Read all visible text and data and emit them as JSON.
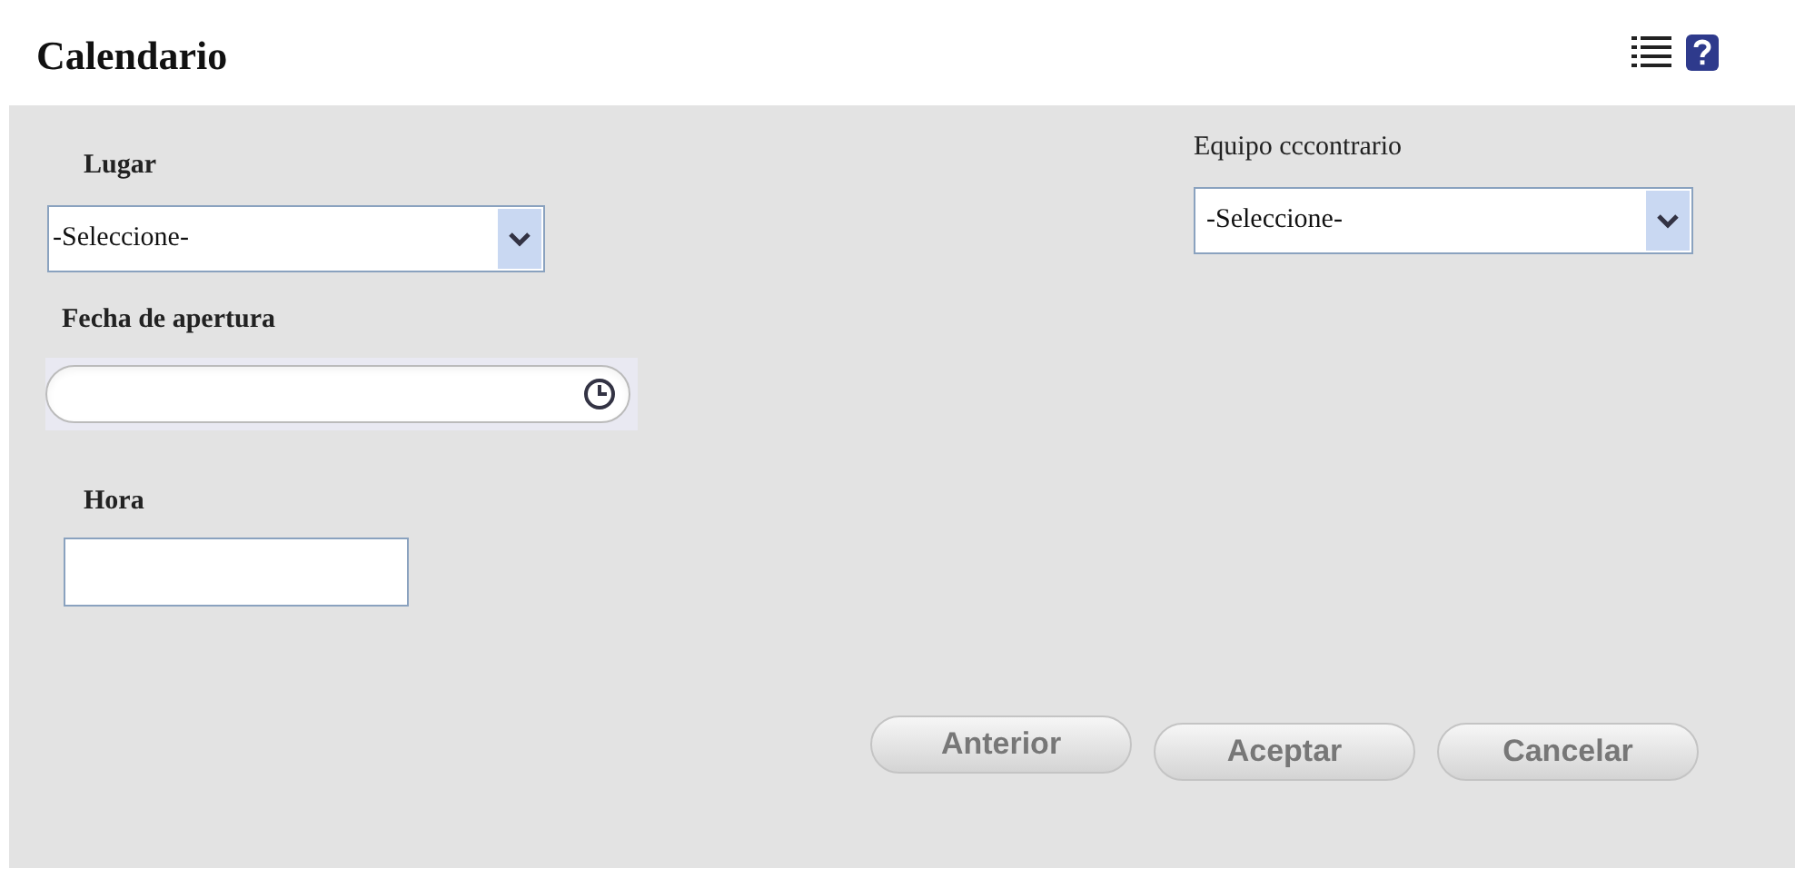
{
  "header": {
    "title": "Calendario"
  },
  "form": {
    "lugar": {
      "label": "Lugar",
      "value": "-Seleccione-"
    },
    "fecha": {
      "label": "Fecha de apertura"
    },
    "hora": {
      "label": "Hora"
    },
    "equipo": {
      "label": "Equipo cccontrario",
      "value": "-Seleccione-"
    }
  },
  "buttons": [
    {
      "label": "Anterior"
    },
    {
      "label": "Aceptar"
    },
    {
      "label": "Cancelar"
    }
  ]
}
